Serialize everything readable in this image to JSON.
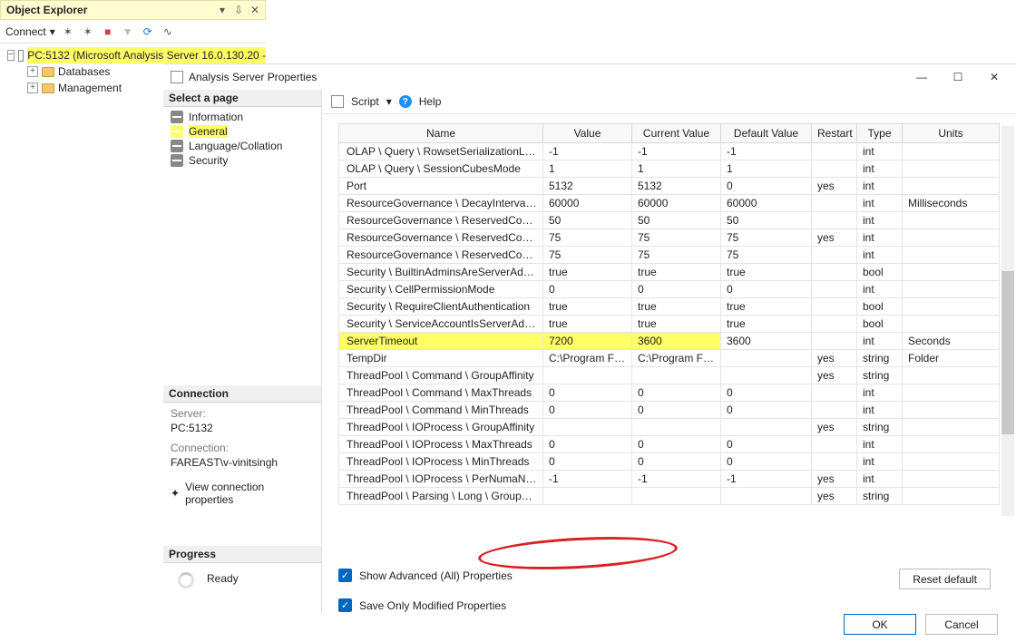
{
  "objectExplorer": {
    "title": "Object Explorer",
    "connectLabel": "Connect",
    "rootNode": "PC:5132 (Microsoft Analysis Server 16.0.130.20 -",
    "children": [
      "Databases",
      "Management"
    ]
  },
  "dialog": {
    "title": "Analysis Server Properties",
    "selectPageHeader": "Select a page",
    "pages": [
      "Information",
      "General",
      "Language/Collation",
      "Security"
    ],
    "selectedPage": "General",
    "connectionHeader": "Connection",
    "serverLabel": "Server:",
    "serverValue": "PC:5132",
    "connectionLabel": "Connection:",
    "connectionValue": "FAREAST\\v-vinitsingh",
    "viewConnProps": "View connection properties",
    "progressHeader": "Progress",
    "progressStatus": "Ready",
    "scriptLabel": "Script",
    "helpLabel": "Help",
    "columns": [
      "Name",
      "Value",
      "Current Value",
      "Default Value",
      "Restart",
      "Type",
      "Units"
    ],
    "rows": [
      {
        "name": "OLAP \\ Query \\ RowsetSerializationLimit",
        "value": "-1",
        "cur": "-1",
        "def": "-1",
        "restart": "",
        "type": "int",
        "units": ""
      },
      {
        "name": "OLAP \\ Query \\ SessionCubesMode",
        "value": "1",
        "cur": "1",
        "def": "1",
        "restart": "",
        "type": "int",
        "units": ""
      },
      {
        "name": "Port",
        "value": "5132",
        "cur": "5132",
        "def": "0",
        "restart": "yes",
        "type": "int",
        "units": ""
      },
      {
        "name": "ResourceGovernance \\ DecayIntervalCPU...",
        "value": "60000",
        "cur": "60000",
        "def": "60000",
        "restart": "",
        "type": "int",
        "units": "Milliseconds"
      },
      {
        "name": "ResourceGovernance \\ ReservedCompute...",
        "value": "50",
        "cur": "50",
        "def": "50",
        "restart": "",
        "type": "int",
        "units": ""
      },
      {
        "name": "ResourceGovernance \\ ReservedCompute...",
        "value": "75",
        "cur": "75",
        "def": "75",
        "restart": "yes",
        "type": "int",
        "units": ""
      },
      {
        "name": "ResourceGovernance \\ ReservedCompute...",
        "value": "75",
        "cur": "75",
        "def": "75",
        "restart": "",
        "type": "int",
        "units": ""
      },
      {
        "name": "Security \\ BuiltinAdminsAreServerAdmins",
        "value": "true",
        "cur": "true",
        "def": "true",
        "restart": "",
        "type": "bool",
        "units": ""
      },
      {
        "name": "Security \\ CellPermissionMode",
        "value": "0",
        "cur": "0",
        "def": "0",
        "restart": "",
        "type": "int",
        "units": ""
      },
      {
        "name": "Security \\ RequireClientAuthentication",
        "value": "true",
        "cur": "true",
        "def": "true",
        "restart": "",
        "type": "bool",
        "units": ""
      },
      {
        "name": "Security \\ ServiceAccountIsServerAdmin",
        "value": "true",
        "cur": "true",
        "def": "true",
        "restart": "",
        "type": "bool",
        "units": ""
      },
      {
        "name": "ServerTimeout",
        "value": "7200",
        "cur": "3600",
        "def": "3600",
        "restart": "",
        "type": "int",
        "units": "Seconds",
        "hl": true
      },
      {
        "name": "TempDir",
        "value": "C:\\Program Files...",
        "cur": "C:\\Program Files...",
        "def": "",
        "restart": "yes",
        "type": "string",
        "units": "Folder"
      },
      {
        "name": "ThreadPool \\ Command \\ GroupAffinity",
        "value": "",
        "cur": "",
        "def": "",
        "restart": "yes",
        "type": "string",
        "units": ""
      },
      {
        "name": "ThreadPool \\ Command \\ MaxThreads",
        "value": "0",
        "cur": "0",
        "def": "0",
        "restart": "",
        "type": "int",
        "units": ""
      },
      {
        "name": "ThreadPool \\ Command \\ MinThreads",
        "value": "0",
        "cur": "0",
        "def": "0",
        "restart": "",
        "type": "int",
        "units": ""
      },
      {
        "name": "ThreadPool \\ IOProcess \\ GroupAffinity",
        "value": "",
        "cur": "",
        "def": "",
        "restart": "yes",
        "type": "string",
        "units": ""
      },
      {
        "name": "ThreadPool \\ IOProcess \\ MaxThreads",
        "value": "0",
        "cur": "0",
        "def": "0",
        "restart": "",
        "type": "int",
        "units": ""
      },
      {
        "name": "ThreadPool \\ IOProcess \\ MinThreads",
        "value": "0",
        "cur": "0",
        "def": "0",
        "restart": "",
        "type": "int",
        "units": ""
      },
      {
        "name": "ThreadPool \\ IOProcess \\ PerNumaNode",
        "value": "-1",
        "cur": "-1",
        "def": "-1",
        "restart": "yes",
        "type": "int",
        "units": ""
      },
      {
        "name": "ThreadPool \\ Parsing \\ Long \\ GroupAffinity",
        "value": "",
        "cur": "",
        "def": "",
        "restart": "yes",
        "type": "string",
        "units": ""
      }
    ],
    "chkShowAdvanced": "Show Advanced (All) Properties",
    "chkSaveOnly": "Save Only Modified Properties",
    "resetLabel": "Reset default",
    "okLabel": "OK",
    "cancelLabel": "Cancel"
  }
}
